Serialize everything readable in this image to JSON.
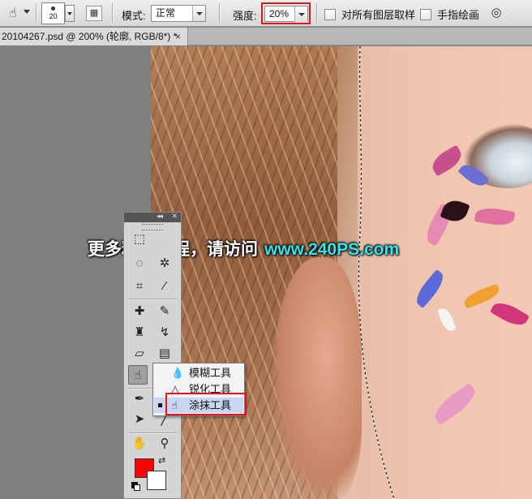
{
  "options_bar": {
    "brush_size": "20",
    "mode_label": "模式:",
    "mode_value": "正常",
    "strength_label": "强度:",
    "strength_value": "20%",
    "sample_all_layers_label": "对所有图层取样",
    "finger_painting_label": "手指绘画"
  },
  "document_tab": {
    "title": "20104267.psd @ 200% (轮廓, RGB/8*) *",
    "close_glyph": "×"
  },
  "watermark": {
    "text_cn": "更多精品教程，请访问",
    "text_url": "www.240PS.com"
  },
  "tools_panel": {
    "collapse_glyph": "◂◂",
    "close_glyph": "✕"
  },
  "tool_flyout": {
    "items": [
      {
        "label": "模糊工具",
        "icon": "blur-icon",
        "glyph": "💧"
      },
      {
        "label": "锐化工具",
        "icon": "sharpen-icon",
        "glyph": "△"
      },
      {
        "label": "涂抹工具",
        "icon": "smudge-icon",
        "glyph": "☝"
      }
    ],
    "selected_index": 2
  },
  "colors": {
    "foreground": "#ff0000",
    "background": "#ffffff",
    "highlight": "#e0141c",
    "watermark_url": "#33e5f0"
  }
}
